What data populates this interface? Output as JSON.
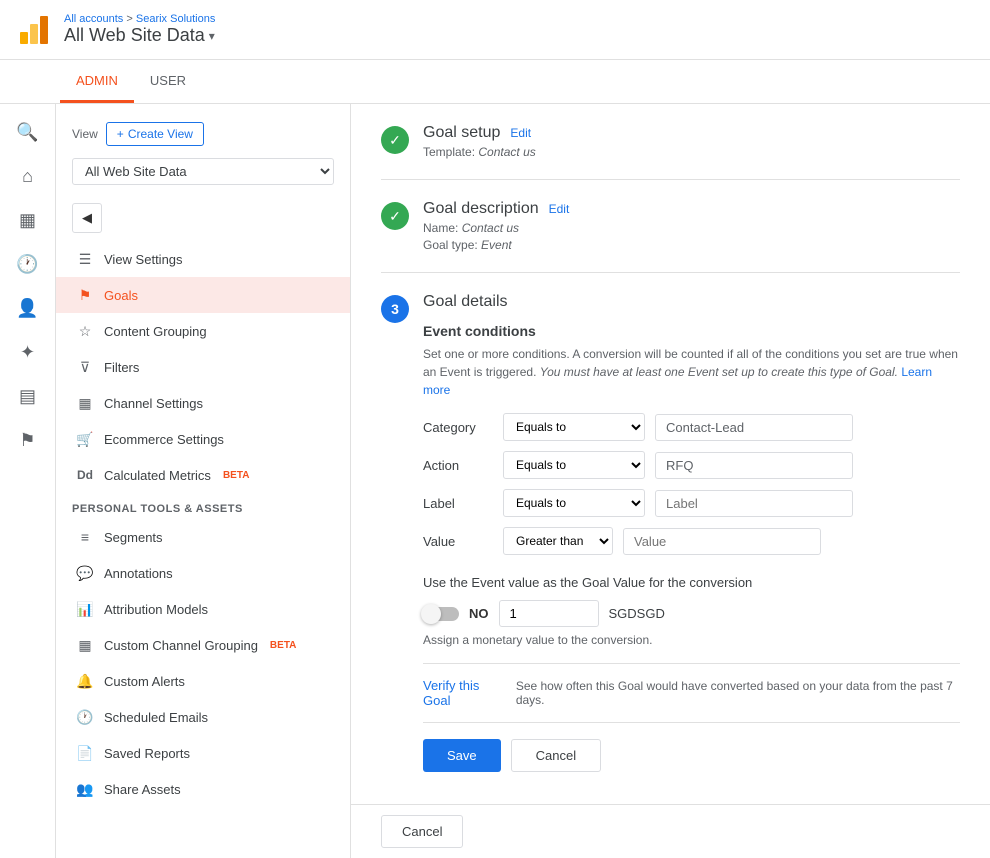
{
  "header": {
    "breadcrumb_link": "All accounts",
    "breadcrumb_separator": ">",
    "breadcrumb_current": "Searix Solutions",
    "site_title": "All Web Site Data",
    "dropdown_arrow": "▾"
  },
  "tabs": {
    "admin_label": "ADMIN",
    "user_label": "USER"
  },
  "nav": {
    "view_label": "View",
    "create_view_label": "+ Create View",
    "dropdown_value": "All Web Site Data",
    "items": [
      {
        "id": "view-settings",
        "label": "View Settings",
        "icon": "☰"
      },
      {
        "id": "goals",
        "label": "Goals",
        "icon": "⚑",
        "active": true
      },
      {
        "id": "content-grouping",
        "label": "Content Grouping",
        "icon": "☆"
      },
      {
        "id": "filters",
        "label": "Filters",
        "icon": "⊽"
      },
      {
        "id": "channel-settings",
        "label": "Channel Settings",
        "icon": "▦"
      },
      {
        "id": "ecommerce-settings",
        "label": "Ecommerce Settings",
        "icon": "🛒"
      },
      {
        "id": "calculated-metrics",
        "label": "Calculated Metrics",
        "icon": "Dd",
        "beta": true
      }
    ],
    "section_label": "PERSONAL TOOLS & ASSETS",
    "tools": [
      {
        "id": "segments",
        "label": "Segments",
        "icon": "≡"
      },
      {
        "id": "annotations",
        "label": "Annotations",
        "icon": "💬"
      },
      {
        "id": "attribution-models",
        "label": "Attribution Models",
        "icon": "📊"
      },
      {
        "id": "custom-channel-grouping",
        "label": "Custom Channel Grouping",
        "icon": "▦",
        "beta": true
      },
      {
        "id": "custom-alerts",
        "label": "Custom Alerts",
        "icon": "🔔"
      },
      {
        "id": "scheduled-emails",
        "label": "Scheduled Emails",
        "icon": "🕐"
      },
      {
        "id": "saved-reports",
        "label": "Saved Reports",
        "icon": "📄"
      },
      {
        "id": "share-assets",
        "label": "Share Assets",
        "icon": "👥"
      }
    ]
  },
  "goal": {
    "step1": {
      "title": "Goal setup",
      "edit_label": "Edit",
      "template_label": "Template:",
      "template_value": "Contact us"
    },
    "step2": {
      "title": "Goal description",
      "edit_label": "Edit",
      "name_label": "Name:",
      "name_value": "Contact us",
      "type_label": "Goal type:",
      "type_value": "Event"
    },
    "step3": {
      "number": "3",
      "title": "Goal details",
      "event_conditions_title": "Event conditions",
      "event_desc_main": "Set one or more conditions. A conversion will be counted if all of the conditions you set are true when an Event is triggered.",
      "event_desc_italic": "You must have at least one Event set up to create this type of Goal.",
      "learn_more": "Learn more",
      "conditions": [
        {
          "label": "Category",
          "operator": "Equals to",
          "value": "Contact-Lead",
          "placeholder": "Contact-Lead"
        },
        {
          "label": "Action",
          "operator": "Equals to",
          "value": "RFQ",
          "placeholder": "RFQ"
        },
        {
          "label": "Label",
          "operator": "Equals to",
          "value": "",
          "placeholder": "Label"
        },
        {
          "label": "Value",
          "operator": "Greater than",
          "value": "",
          "placeholder": "Value"
        }
      ],
      "toggle_label": "Use the Event value as the Goal Value for the conversion",
      "no_label": "NO",
      "value_input": "1",
      "currency": "SGDSGD",
      "assign_text": "Assign a monetary value to the conversion.",
      "verify_link": "Verify this Goal",
      "verify_desc": "See how often this Goal would have converted based on your data from the past 7 days.",
      "save_label": "Save",
      "cancel_label": "Cancel"
    }
  },
  "bottom_cancel": "Cancel",
  "icon_sidebar": {
    "items": [
      {
        "id": "search",
        "icon": "🔍"
      },
      {
        "id": "home",
        "icon": "⌂"
      },
      {
        "id": "reports",
        "icon": "▦"
      },
      {
        "id": "clock",
        "icon": "🕐"
      },
      {
        "id": "user",
        "icon": "👤"
      },
      {
        "id": "discover",
        "icon": "✦"
      },
      {
        "id": "table",
        "icon": "▤"
      },
      {
        "id": "flag",
        "icon": "⚑"
      }
    ]
  }
}
